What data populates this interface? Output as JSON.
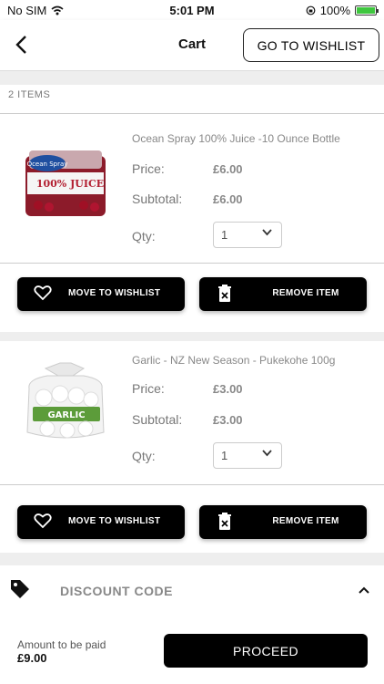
{
  "status_bar": {
    "carrier": "No SIM",
    "time": "5:01 PM",
    "battery": "100%"
  },
  "nav": {
    "title": "Cart",
    "wishlist_button": "GO TO WISHLIST"
  },
  "cart": {
    "count_label": "2 ITEMS",
    "items": [
      {
        "name": "Ocean Spray 100% Juice -10 Ounce Bottle",
        "price_label": "Price:",
        "price": "£6.00",
        "subtotal_label": "Subtotal:",
        "subtotal": "£6.00",
        "qty_label": "Qty:",
        "qty": "1",
        "image_text": "100% JUICE",
        "brand_text": "Ocean Spray",
        "move_label": "MOVE TO WISHLIST",
        "remove_label": "REMOVE ITEM"
      },
      {
        "name": "Garlic - NZ New Season - Pukekohe 100g",
        "price_label": "Price:",
        "price": "£3.00",
        "subtotal_label": "Subtotal:",
        "subtotal": "£3.00",
        "qty_label": "Qty:",
        "qty": "1",
        "image_text": "GARLIC",
        "move_label": "MOVE TO WISHLIST",
        "remove_label": "REMOVE ITEM"
      }
    ]
  },
  "discount": {
    "label": "DISCOUNT CODE"
  },
  "footer": {
    "amount_label": "Amount to be paid",
    "amount": "£9.00",
    "proceed_label": "PROCEED"
  },
  "colors": {
    "accent": "#000000",
    "muted_text": "#888888",
    "battery": "#3ec63e"
  }
}
